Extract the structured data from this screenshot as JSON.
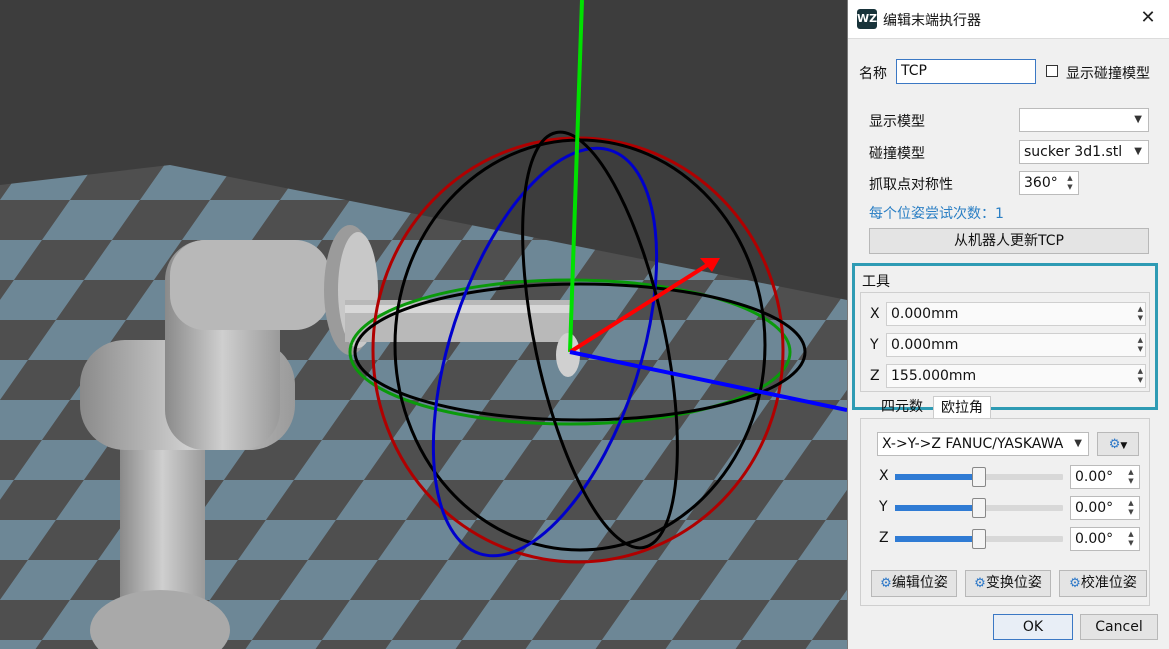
{
  "dialog": {
    "title": "编辑末端执行器",
    "logo_text": "WZ",
    "name_label": "名称",
    "name_value": "TCP",
    "show_collision_label": "显示碰撞模型",
    "display_model_label": "显示模型",
    "display_model_value": "",
    "collision_model_label": "碰撞模型",
    "collision_model_value": "sucker 3d1.stl",
    "symmetry_label": "抓取点对称性",
    "symmetry_value": "360°",
    "attempts_text": "每个位姿尝试次数：1",
    "update_tcp_label": "从机器人更新TCP",
    "tool_group_label": "工具",
    "tool": {
      "x_label": "X",
      "x_value": "0.000mm",
      "y_label": "Y",
      "y_value": "0.000mm",
      "z_label": "Z",
      "z_value": "155.000mm"
    },
    "tabs": [
      "四元数",
      "欧拉角"
    ],
    "euler_convention": "X->Y->Z FANUC/YASKAWA",
    "rotation": {
      "x_label": "X",
      "x_value": "0.00°",
      "x_level": 0.5,
      "y_label": "Y",
      "y_value": "0.00°",
      "y_level": 0.5,
      "z_label": "Z",
      "z_value": "0.00°",
      "z_level": 0.5
    },
    "edit_pose_label": "编辑位姿",
    "transform_pose_label": "变换位姿",
    "calibrate_pose_label": "校准位姿",
    "ok_label": "OK",
    "cancel_label": "Cancel"
  },
  "colors": {
    "accent": "#2e9bb4",
    "link": "#2b7fc4",
    "slider": "#2f7bd4",
    "axis_x": "#ff0000",
    "axis_y": "#00e000",
    "axis_z": "#0000ff"
  },
  "icons": [
    "app-logo-icon",
    "close-icon",
    "chevron-down-icon",
    "gear-icon",
    "spin-arrows-icon"
  ]
}
